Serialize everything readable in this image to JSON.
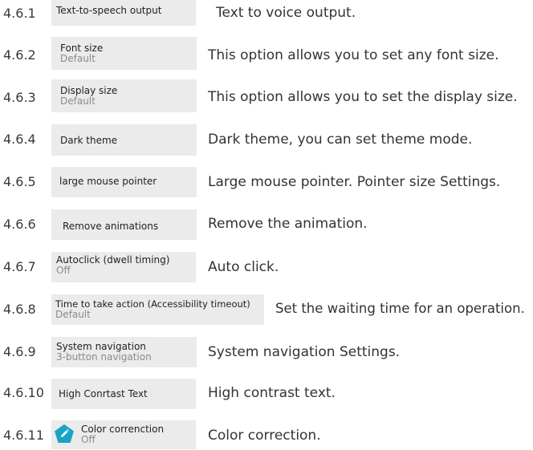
{
  "items": [
    {
      "num": "4.6.1",
      "title": "Text-to-speech output",
      "sub": "",
      "desc": "Text to voice output."
    },
    {
      "num": "4.6.2",
      "title": "Font size",
      "sub": "Default",
      "desc": "This option allows you to set any font size."
    },
    {
      "num": "4.6.3",
      "title": "Display size",
      "sub": "Default",
      "desc": "This option allows you to set the display size."
    },
    {
      "num": "4.6.4",
      "title": "Dark theme",
      "sub": "",
      "desc": "Dark theme, you can set theme mode."
    },
    {
      "num": "4.6.5",
      "title": "large mouse pointer",
      "sub": "",
      "desc": "Large mouse pointer. Pointer size Settings."
    },
    {
      "num": "4.6.6",
      "title": "Remove animations",
      "sub": "",
      "desc": "Remove the animation."
    },
    {
      "num": "4.6.7",
      "title": "Autoclick (dwell timing)",
      "sub": "Off",
      "desc": "Auto click."
    },
    {
      "num": "4.6.8",
      "title": "Time to take action (Accessibility timeout)",
      "sub": "Default",
      "desc": "Set the waiting time for an operation."
    },
    {
      "num": "4.6.9",
      "title": "System navigation",
      "sub": "3-button navigation",
      "desc": "System navigation Settings."
    },
    {
      "num": "4.6.10",
      "title": "High Conrtast Text",
      "sub": "",
      "desc": "High contrast text."
    },
    {
      "num": "4.6.11",
      "title": "Color correnction",
      "sub": "Off",
      "desc": "Color correction."
    }
  ],
  "icons": {
    "color_correction": "pencil-icon",
    "badge_color": "#1aa3c4"
  }
}
